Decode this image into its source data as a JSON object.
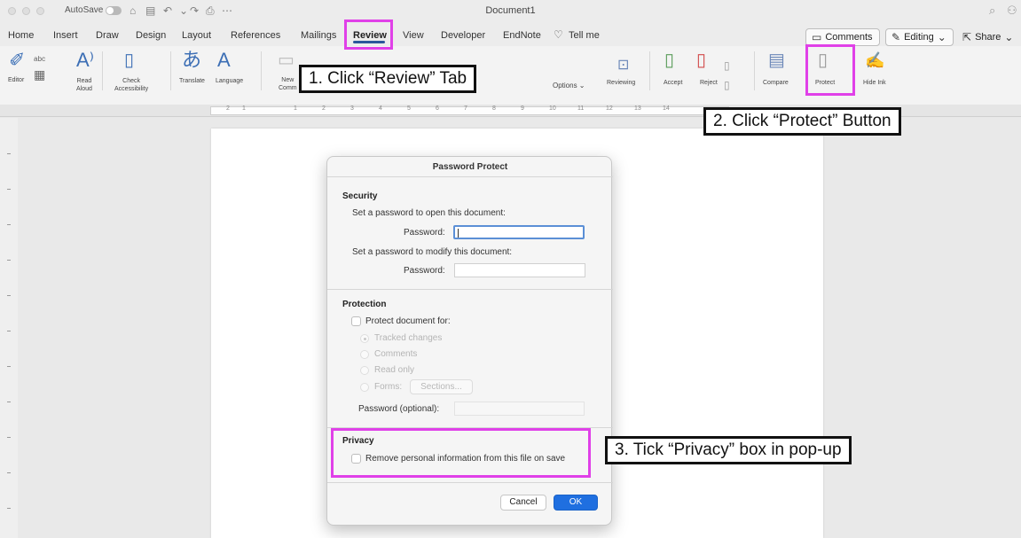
{
  "titlebar": {
    "autosave_label": "AutoSave",
    "doc_title": "Document1",
    "quick_icons": [
      "home-icon",
      "save-icon",
      "undo-icon",
      "redo-icon",
      "print-icon",
      "more-icon"
    ]
  },
  "tabs": [
    "Home",
    "Insert",
    "Draw",
    "Design",
    "Layout",
    "References",
    "Mailings",
    "Review",
    "View",
    "Developer",
    "EndNote"
  ],
  "active_tab": "Review",
  "tell_me": "Tell me",
  "header_buttons": {
    "comments": "Comments",
    "editing": "Editing",
    "share": "Share"
  },
  "ribbon": {
    "editor": "Editor",
    "read_aloud": "Read Aloud",
    "check_accessibility_1": "Check",
    "check_accessibility_2": "Accessibility",
    "translate": "Translate",
    "language": "Language",
    "new_comment": "New",
    "new_comment_2": "Comm",
    "options": "Options",
    "reviewing": "Reviewing",
    "accept": "Accept",
    "reject": "Reject",
    "compare": "Compare",
    "protect": "Protect",
    "hide_ink": "Hide Ink"
  },
  "ruler_numbers": [
    "2",
    "1",
    "1",
    "2",
    "3",
    "4",
    "5",
    "6",
    "7",
    "8",
    "9",
    "10",
    "11",
    "12",
    "13",
    "14"
  ],
  "dialog": {
    "title": "Password Protect",
    "security": {
      "heading": "Security",
      "open_label": "Set a password to open this document:",
      "password_label": "Password:",
      "modify_label": "Set a password to modify this document:",
      "password_label_2": "Password:"
    },
    "protection": {
      "heading": "Protection",
      "protect_for": "Protect document for:",
      "options": [
        "Tracked changes",
        "Comments",
        "Read only",
        "Forms:"
      ],
      "selected_option": "Tracked changes",
      "sections_button": "Sections...",
      "optional_password_label": "Password (optional):"
    },
    "privacy": {
      "heading": "Privacy",
      "remove_info": "Remove personal information from this file on save"
    },
    "cancel": "Cancel",
    "ok": "OK"
  },
  "annotations": {
    "step1": "1. Click “Review” Tab",
    "step2": "2. Click “Protect” Button",
    "step3": "3. Tick “Privacy” box in pop-up",
    "highlight_color": "#e040e8"
  },
  "colors": {
    "accent": "#2b579a",
    "ok_button": "#1f6fe0"
  }
}
